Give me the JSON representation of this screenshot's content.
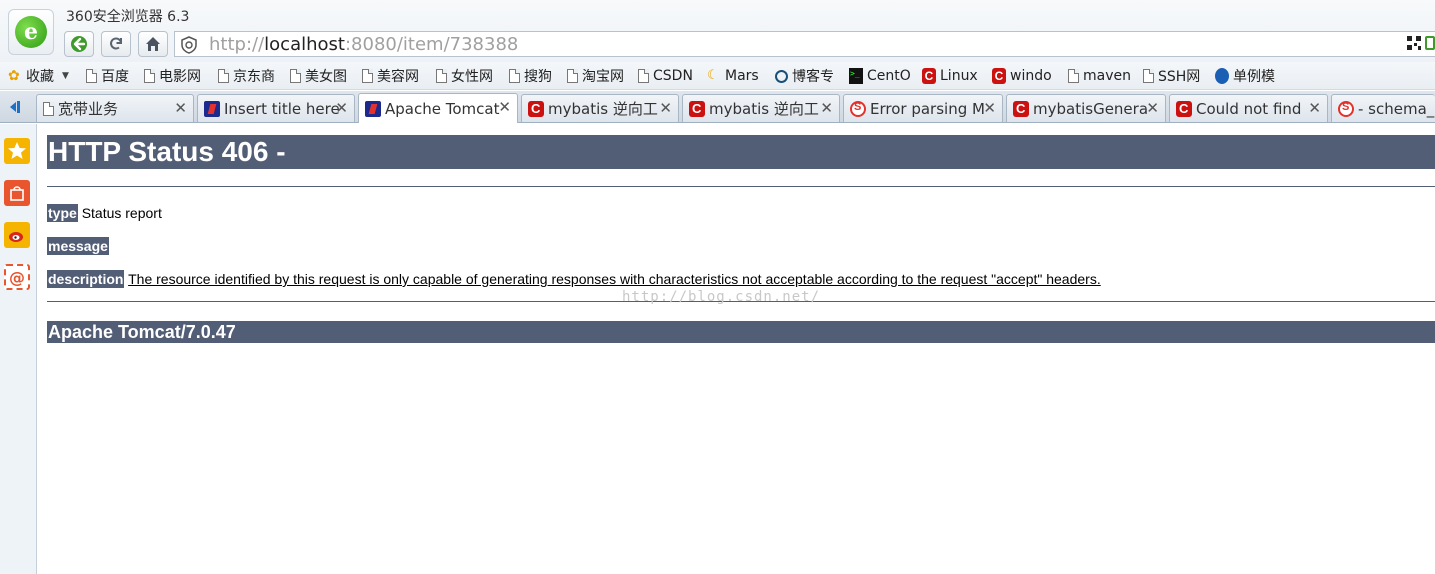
{
  "window": {
    "title": "360安全浏览器 6.3"
  },
  "address_bar": {
    "scheme": "http://",
    "host": "localhost",
    "rest": ":8080/item/738388"
  },
  "bookmarks": [
    {
      "label": "收藏",
      "icon": "star-icon"
    },
    {
      "label": "百度",
      "icon": "page-icon"
    },
    {
      "label": "电影网",
      "icon": "page-icon"
    },
    {
      "label": "京东商",
      "icon": "page-icon"
    },
    {
      "label": "美女图",
      "icon": "page-icon"
    },
    {
      "label": "美容网",
      "icon": "page-icon"
    },
    {
      "label": "女性网",
      "icon": "page-icon"
    },
    {
      "label": "搜狗",
      "icon": "page-icon"
    },
    {
      "label": "淘宝网",
      "icon": "page-icon"
    },
    {
      "label": "CSDN",
      "icon": "page-icon"
    },
    {
      "label": "Mars",
      "icon": "mars-icon"
    },
    {
      "label": "博客专",
      "icon": "cnblogs-icon"
    },
    {
      "label": "CentO",
      "icon": "terminal-icon"
    },
    {
      "label": "Linux",
      "icon": "csdn-icon"
    },
    {
      "label": "windo",
      "icon": "csdn-icon"
    },
    {
      "label": "maven",
      "icon": "page-icon"
    },
    {
      "label": "SSH网",
      "icon": "page-icon"
    },
    {
      "label": "单例模",
      "icon": "globe-icon"
    }
  ],
  "tabs": [
    {
      "label": "宽带业务",
      "icon": "page-icon"
    },
    {
      "label": "Insert title here",
      "icon": "eclipse-icon"
    },
    {
      "label": "Apache Tomcat",
      "icon": "eclipse-icon",
      "active": true
    },
    {
      "label": "mybatis 逆向工",
      "icon": "csdn-icon"
    },
    {
      "label": "mybatis 逆向工",
      "icon": "csdn-icon"
    },
    {
      "label": "Error parsing M",
      "icon": "sogou-icon"
    },
    {
      "label": "mybatisGenera",
      "icon": "csdn-icon"
    },
    {
      "label": "Could not find",
      "icon": "csdn-icon"
    },
    {
      "label": "- schema_r",
      "icon": "sogou-icon"
    }
  ],
  "tab_close_glyph": "✕",
  "page": {
    "heading": "HTTP Status 406 -",
    "type_label": "type",
    "type_value": "Status report",
    "message_label": "message",
    "description_label": "description",
    "description_value": "The resource identified by this request is only capable of generating responses with characteristics not acceptable according to the request \"accept\" headers.",
    "footer": "Apache Tomcat/7.0.47",
    "watermark": "http://blog.csdn.net/"
  },
  "colors": {
    "tomcat_header": "#525d76",
    "logo_green": "#2e9c13",
    "csdn_red": "#cc1111"
  }
}
